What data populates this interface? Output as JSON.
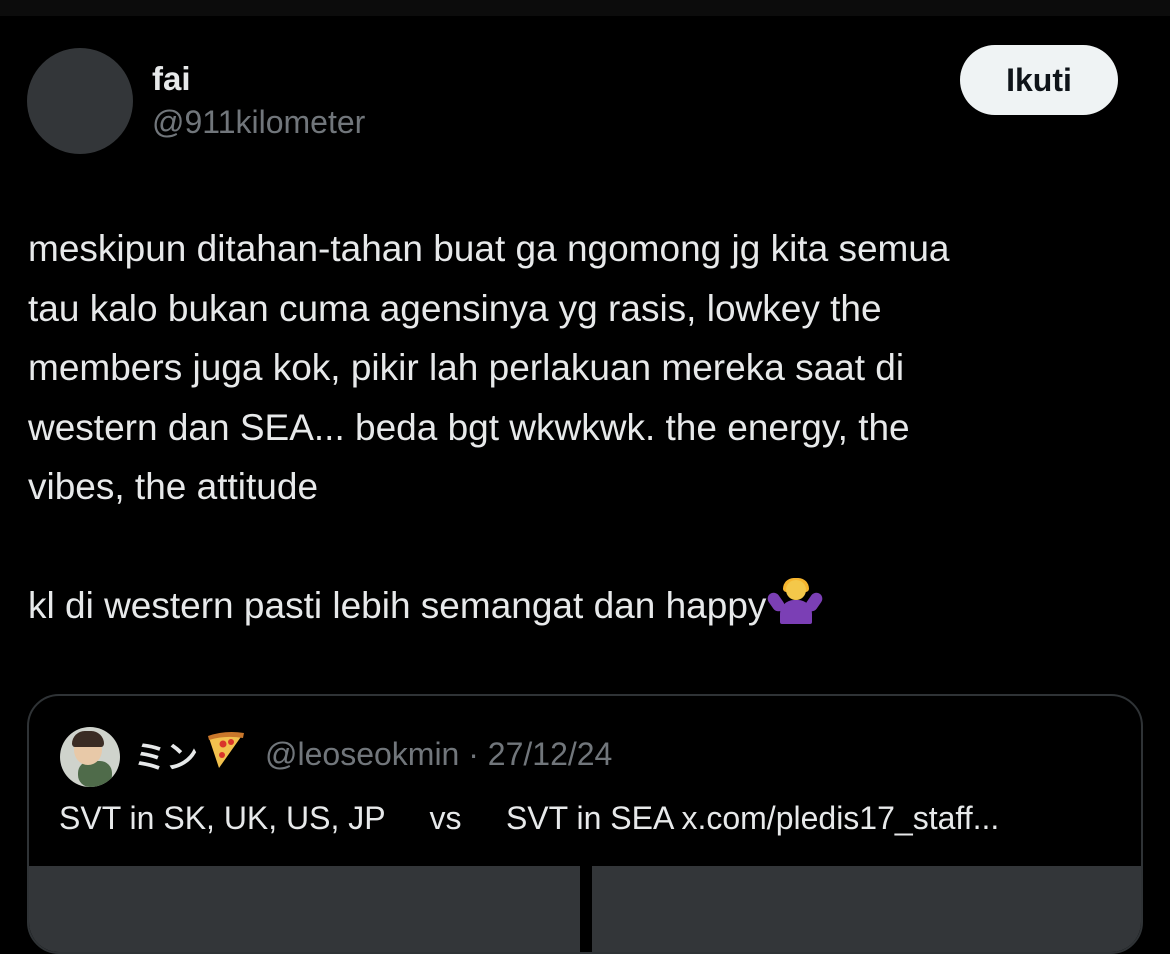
{
  "author": {
    "display_name": "fai",
    "handle": "@911kilometer",
    "follow_label": "Ikuti"
  },
  "tweet": {
    "lines": [
      "meskipun ditahan-tahan buat ga ngomong jg kita semua",
      "tau kalo bukan cuma agensinya yg rasis, lowkey the",
      "members juga kok, pikir lah perlakuan mereka saat di",
      "western dan SEA... beda bgt wkwkwk. the energy, the",
      "vibes, the attitude"
    ],
    "last_line": "kl di western pasti lebih semangat dan happy",
    "emoji_icon": "person-shrugging-icon"
  },
  "quote": {
    "display_name": "ミン",
    "name_emoji_icon": "pizza-icon",
    "meta": "@leoseokmin · 27/12/24",
    "text": "SVT in SK, UK, US, JP     vs     SVT in SEA x.com/pledis17_staff..."
  },
  "colors": {
    "background": "#000000",
    "text_primary": "#e7e9ea",
    "text_secondary": "#71767b",
    "follow_button_bg": "#eff3f4",
    "border": "#2f3336",
    "media_placeholder": "#333639"
  }
}
